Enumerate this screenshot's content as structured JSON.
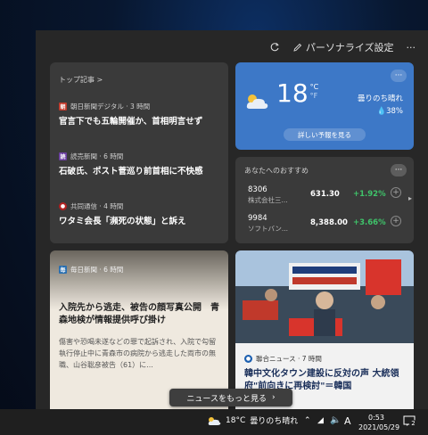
{
  "header": {
    "personalize_label": "パーソナライズ設定",
    "more_label": "···"
  },
  "top_stories": {
    "title": "トップ記事 >",
    "items": [
      {
        "logo": "朝",
        "logo_color": "#c0392b",
        "source": "朝日新聞デジタル · 3 時間",
        "headline": "官言下でも五輪開催か、首相明言せず"
      },
      {
        "logo": "読",
        "logo_color": "#6b3fa0",
        "source": "読売新聞 · 6 時間",
        "headline": "石破氏、ポスト菅巡り前首相に不快感"
      },
      {
        "logo": "●",
        "logo_color": "#b22222",
        "source": "共同通信 · 4 時間",
        "headline": "ワタミ会長「瀕死の状態」と訴え"
      }
    ]
  },
  "weather": {
    "temp": "18",
    "unit_c": "°C",
    "unit_f": "°F",
    "condition": "曇りのち晴れ",
    "humidity": "38%",
    "forecast_button": "詳しい予報を見る"
  },
  "stocks": {
    "title": "あなたへのおすすめ",
    "items": [
      {
        "code": "8306",
        "name": "株式会社三...",
        "price": "631.30",
        "change": "+1.92%"
      },
      {
        "code": "9984",
        "name": "ソフトバン...",
        "price": "8,388.00",
        "change": "+3.66%"
      }
    ]
  },
  "mainichi": {
    "logo": "毎",
    "source": "毎日新聞 · 6 時間",
    "headline": "入院先から逃走、被告の顔写真公開　青森地検が情報提供呼び掛け",
    "body": "傷害や恐喝未遂などの罪で起訴され、入院で勾留執行停止中に青森市の病院から逃走した両市の無職、山谷聡彦被告（61）に..."
  },
  "photo_news": {
    "source": "聯合ニュース · 7 時間",
    "headline": "韓中文化タウン建設に反対の声 大統領府\"前向きに再検討\"＝韓国"
  },
  "more_news_button": "ニュースをもっと見る",
  "taskbar": {
    "weather_temp": "18°C",
    "weather_cond": "曇りのち晴れ",
    "ime": "A",
    "time": "0:53",
    "date": "2021/05/29",
    "notification_count": "2"
  }
}
